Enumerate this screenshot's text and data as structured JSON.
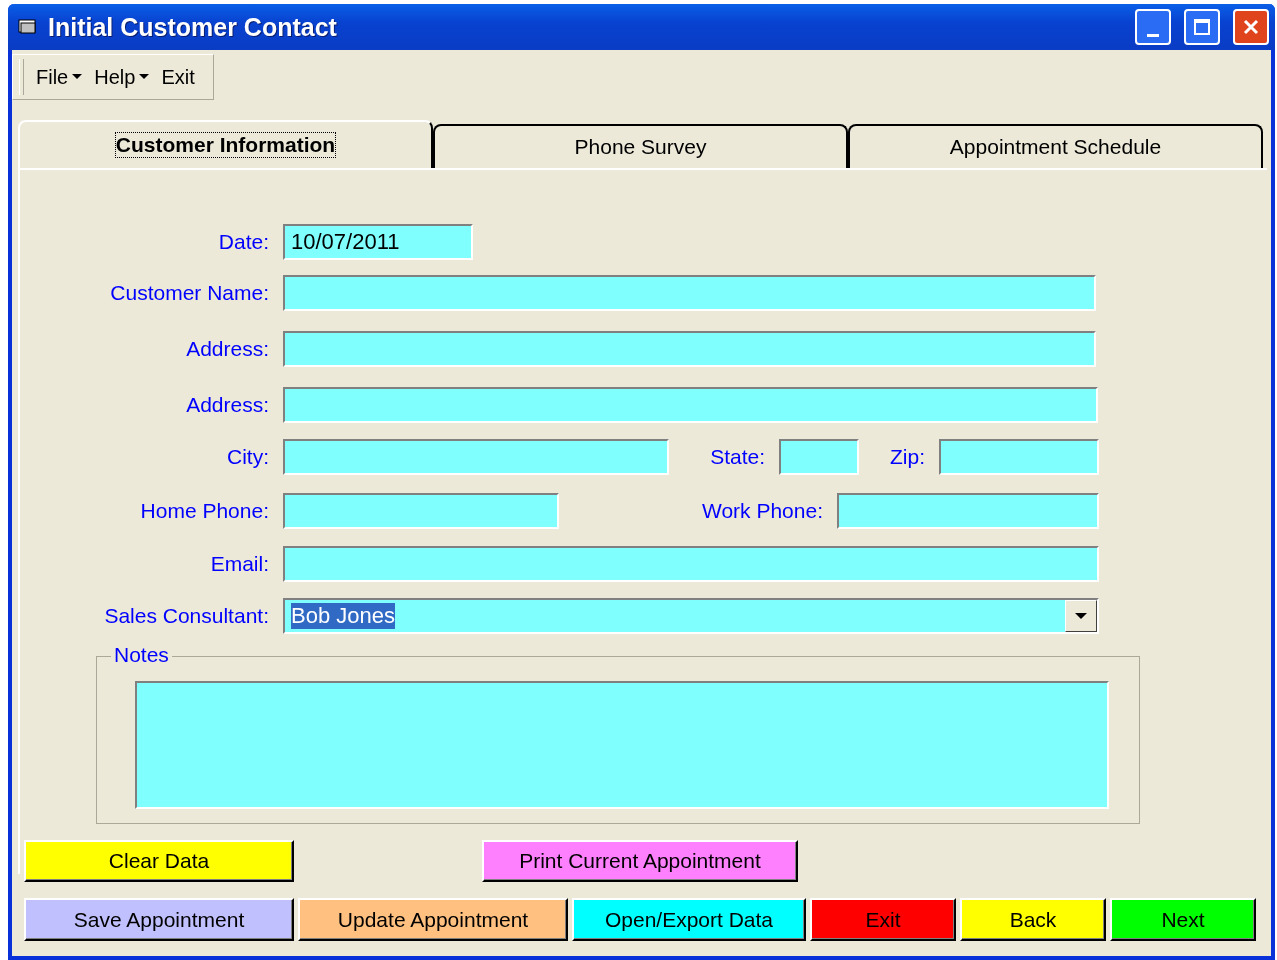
{
  "window": {
    "title": "Initial Customer Contact"
  },
  "menu": [
    {
      "label": "File",
      "kind": "dropdown"
    },
    {
      "label": "Help",
      "kind": "dropdown"
    },
    {
      "label": "Exit",
      "kind": "plain"
    }
  ],
  "tabs": [
    {
      "label": "Customer Information",
      "selected": true
    },
    {
      "label": "Phone Survey",
      "selected": false
    },
    {
      "label": "Appointment Schedule",
      "selected": false
    }
  ],
  "rows": [
    {
      "fields": [
        {
          "label": "Date:",
          "value": "10/07/2011",
          "kind": "text"
        }
      ]
    },
    {
      "fields": [
        {
          "label": "Customer Name:",
          "kind": "text"
        }
      ]
    },
    {
      "fields": [
        {
          "label": "Address:",
          "kind": "text"
        }
      ]
    },
    {
      "fields": [
        {
          "label": "Address:",
          "kind": "text"
        }
      ]
    },
    {
      "fields": [
        {
          "label": "City:",
          "kind": "text"
        },
        {
          "label": "State:",
          "kind": "text"
        },
        {
          "label": "Zip:",
          "kind": "text"
        }
      ]
    },
    {
      "fields": [
        {
          "label": "Home Phone:",
          "kind": "text"
        },
        {
          "label": "Work Phone:",
          "kind": "text"
        }
      ]
    },
    {
      "fields": [
        {
          "label": "Email:",
          "kind": "text"
        }
      ]
    },
    {
      "fields": [
        {
          "label": "Sales Consultant:",
          "value": "Bob Jones",
          "kind": "dropdown"
        }
      ]
    }
  ],
  "notes": {
    "label": "Notes"
  },
  "buttons_top": [
    {
      "label": "Clear Data",
      "color": "#ffff00"
    },
    {
      "label": "Print Current Appointment",
      "color": "#ff80ff"
    }
  ],
  "buttons_bottom": [
    {
      "label": "Save Appointment",
      "color": "#c0c0ff"
    },
    {
      "label": "Update Appointment",
      "color": "#ffc080"
    },
    {
      "label": "Open/Export Data",
      "color": "#00ffff"
    },
    {
      "label": "Exit",
      "color": "#ff0000"
    },
    {
      "label": "Back",
      "color": "#ffff00"
    },
    {
      "label": "Next",
      "color": "#00ff00"
    }
  ]
}
